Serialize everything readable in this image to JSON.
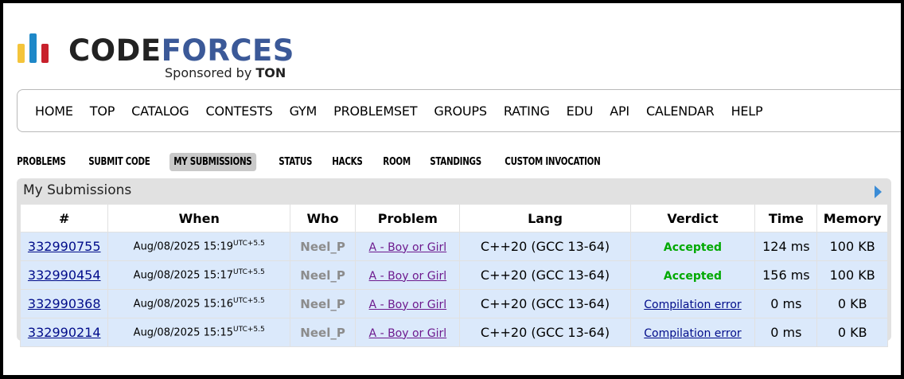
{
  "logo": {
    "brand_a": "CODE",
    "brand_b": "FORCES",
    "sponsor_prefix": "Sponsored by ",
    "sponsor_name": "TON"
  },
  "menu": [
    "HOME",
    "TOP",
    "CATALOG",
    "CONTESTS",
    "GYM",
    "PROBLEMSET",
    "GROUPS",
    "RATING",
    "EDU",
    "API",
    "CALENDAR",
    "HELP"
  ],
  "submenu": [
    "PROBLEMS",
    "SUBMIT CODE",
    "MY SUBMISSIONS",
    "STATUS",
    "HACKS",
    "ROOM",
    "STANDINGS",
    "CUSTOM INVOCATION"
  ],
  "submenu_active": "MY SUBMISSIONS",
  "box": {
    "title": "My Submissions"
  },
  "table": {
    "headers": [
      "#",
      "When",
      "Who",
      "Problem",
      "Lang",
      "Verdict",
      "Time",
      "Memory"
    ],
    "rows": [
      {
        "id": "332990755",
        "when": "Aug/08/2025 15:19",
        "tz": "UTC+5.5",
        "who": "Neel_P",
        "problem": "A - Boy or Girl",
        "lang": "C++20 (GCC 13-64)",
        "verdict": "Accepted",
        "time": "124 ms",
        "memory": "100 KB"
      },
      {
        "id": "332990454",
        "when": "Aug/08/2025 15:17",
        "tz": "UTC+5.5",
        "who": "Neel_P",
        "problem": "A - Boy or Girl",
        "lang": "C++20 (GCC 13-64)",
        "verdict": "Accepted",
        "time": "156 ms",
        "memory": "100 KB"
      },
      {
        "id": "332990368",
        "when": "Aug/08/2025 15:16",
        "tz": "UTC+5.5",
        "who": "Neel_P",
        "problem": "A - Boy or Girl",
        "lang": "C++20 (GCC 13-64)",
        "verdict": "Compilation error",
        "time": "0 ms",
        "memory": "0 KB"
      },
      {
        "id": "332990214",
        "when": "Aug/08/2025 15:15",
        "tz": "UTC+5.5",
        "who": "Neel_P",
        "problem": "A - Boy or Girl",
        "lang": "C++20 (GCC 13-64)",
        "verdict": "Compilation error",
        "time": "0 ms",
        "memory": "0 KB"
      }
    ]
  },
  "colors": {
    "accepted": "#00a900",
    "link": "#000c8a",
    "problem_link": "#6d1a8e",
    "row_bg": "#dbe9fb"
  }
}
